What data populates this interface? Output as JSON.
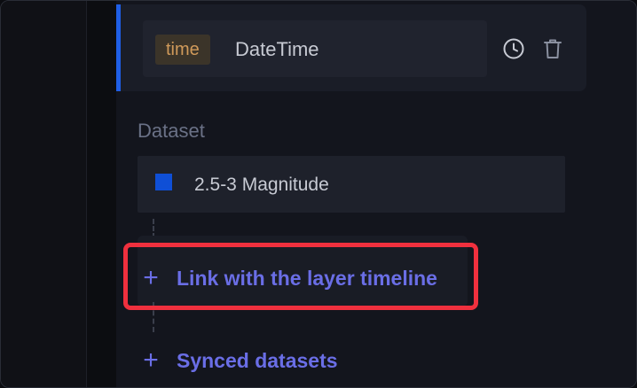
{
  "field": {
    "type_badge": "time",
    "name": "DateTime",
    "actions": [
      {
        "icon": "clock-icon"
      },
      {
        "icon": "trash-icon"
      }
    ]
  },
  "dataset_section": {
    "label": "Dataset",
    "items": [
      {
        "name": "2.5-3 Magnitude",
        "color": "#0f4fd6"
      }
    ]
  },
  "actions": {
    "link_layer_timeline": {
      "plus": "+",
      "label": "Link with the layer timeline"
    },
    "synced_datasets": {
      "plus": "+",
      "label": "Synced datasets"
    }
  },
  "colors": {
    "accent": "#1f5ee6",
    "badge_text": "#d09a5a",
    "link": "#6a6ee6",
    "highlight": "#f0303e"
  }
}
